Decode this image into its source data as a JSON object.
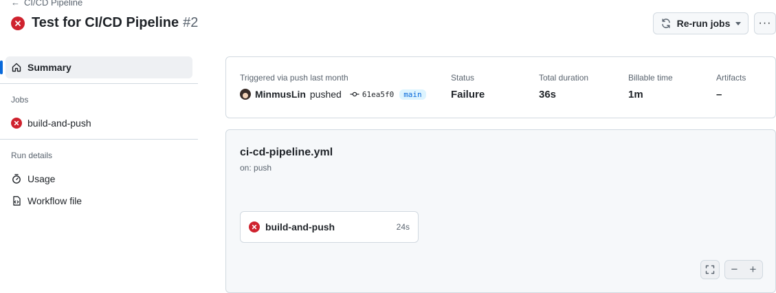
{
  "header": {
    "back_label": "CI/CD Pipeline",
    "title": "Test for CI/CD Pipeline",
    "run_number": "#2",
    "rerun_label": "Re-run jobs",
    "more_label": "···"
  },
  "sidebar": {
    "summary_label": "Summary",
    "jobs_section": "Jobs",
    "jobs": [
      {
        "label": "build-and-push",
        "status": "failure"
      }
    ],
    "run_details_section": "Run details",
    "usage_label": "Usage",
    "workflow_file_label": "Workflow file"
  },
  "summary": {
    "triggered_label": "Triggered via push last month",
    "actor": "MinmusLin",
    "action": "pushed",
    "commit": "61ea5f0",
    "branch": "main",
    "status_label": "Status",
    "status_value": "Failure",
    "duration_label": "Total duration",
    "duration_value": "36s",
    "billable_label": "Billable time",
    "billable_value": "1m",
    "artifacts_label": "Artifacts",
    "artifacts_value": "–"
  },
  "graph": {
    "workflow_file": "ci-cd-pipeline.yml",
    "trigger": "on: push",
    "job": {
      "name": "build-and-push",
      "duration": "24s",
      "status": "failure"
    },
    "zoom_out": "−",
    "zoom_in": "+"
  },
  "colors": {
    "failure": "#cf222e",
    "accent": "#0969da",
    "muted_text": "#59636e",
    "border": "#d1d9e0"
  }
}
